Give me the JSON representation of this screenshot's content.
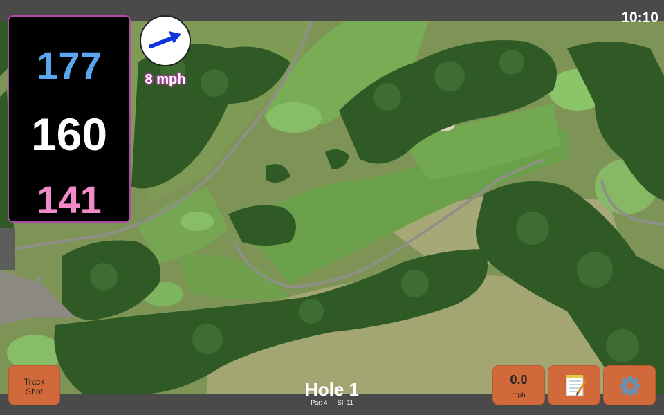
{
  "status_bar": {
    "time": "10:10"
  },
  "distances": {
    "back": "177",
    "middle": "160",
    "front": "141"
  },
  "wind": {
    "speed_label": "8 mph",
    "arrow_icon": "arrow-right-icon"
  },
  "hole": {
    "title": "Hole 1",
    "par_label": "Par: 4",
    "si_label": "SI: 11"
  },
  "buttons": {
    "track_shot_line1": "Track",
    "track_shot_line2": "Shot",
    "speed_value": "0.0",
    "speed_unit": "mph",
    "notes_icon": "notepad-icon",
    "settings_icon": "gear-icon"
  },
  "colors": {
    "back": "#5aa6f0",
    "middle": "#ffffff",
    "front": "#f08ac8",
    "button": "#d2693a",
    "accent": "#b04aa8"
  }
}
